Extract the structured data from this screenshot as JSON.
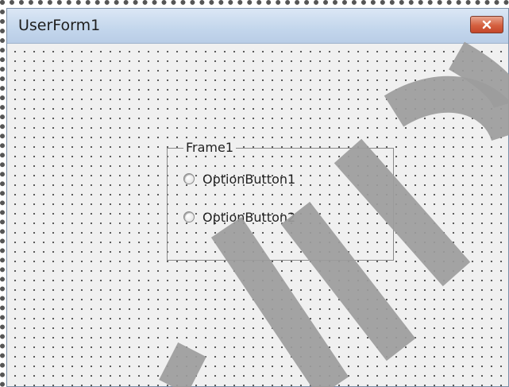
{
  "window": {
    "title": "UserForm1"
  },
  "frame": {
    "caption": "Frame1",
    "options": [
      {
        "label": "OptionButton1",
        "selected": false
      },
      {
        "label": "OptionButton2",
        "selected": false
      }
    ]
  },
  "colors": {
    "titlebar": "#c3d6ec",
    "close_button": "#d5603f",
    "client": "#f0f0f0",
    "watermark": "#9c9c9c"
  },
  "icons": {
    "close": "close-icon",
    "radio": "radio-icon"
  }
}
